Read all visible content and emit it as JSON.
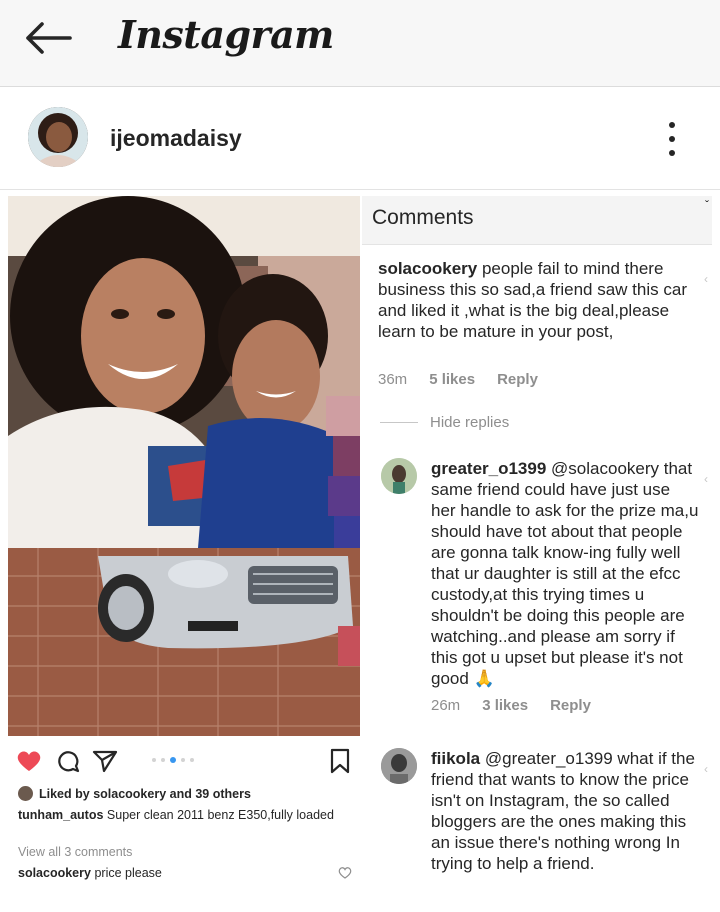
{
  "app": {
    "title": "Instagram"
  },
  "post": {
    "username": "ijeomadaisy",
    "liked_by_user": "solacookery",
    "liked_by_others": "39 others",
    "caption_user": "tunham_autos",
    "caption_text": "Super clean 2011 benz E350,fully loaded",
    "view_all": "View all 3 comments",
    "comment_user": "solacookery",
    "comment_text": "price please"
  },
  "comments_panel": {
    "title": "Comments",
    "hide_replies": "Hide replies",
    "comments": [
      {
        "user": "solacookery",
        "text": "people fail to mind there business this so sad,a friend saw this car and liked it ,what is the big deal,please learn to be mature in your post,",
        "time": "36m",
        "likes": "5 likes",
        "reply": "Reply"
      },
      {
        "user": "greater_o1399",
        "text": "@solacookery that same friend could have just use her handle to ask for the prize ma,u should have tot about that people are gonna talk know-ing fully well that ur daughter is still at the efcc custody,at this trying times u shouldn't be doing this people are watching..and please am sorry if this got u upset but please it's not good 🙏",
        "time": "26m",
        "likes": "3 likes",
        "reply": "Reply"
      },
      {
        "user": "fiikola",
        "text": "@greater_o1399 what if the friend that wants to know the price isn't on Instagram, the so called bloggers are the ones making this an issue there's nothing wrong In trying to help a friend."
      }
    ]
  },
  "icons": {
    "back": "arrow-left-icon",
    "more": "more-vertical-icon",
    "like": "heart-filled-icon",
    "comment": "comment-bubble-icon",
    "share": "paper-plane-icon",
    "save": "bookmark-icon"
  },
  "colors": {
    "heart": "#ed4956",
    "dot_active": "#3897f0",
    "muted": "#8e8e8e"
  }
}
